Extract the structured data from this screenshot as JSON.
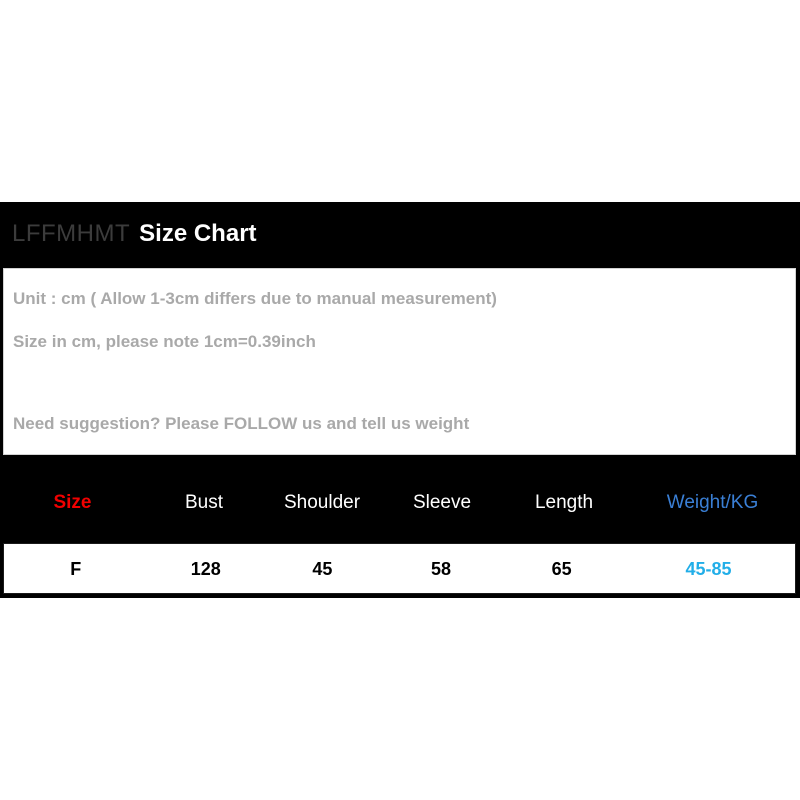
{
  "title": {
    "brand": "LFFMHMT",
    "main": "Size Chart"
  },
  "info": {
    "line1": "Unit : cm ( Allow 1-3cm differs due to manual measurement)",
    "line2": "Size in cm, please note 1cm=0.39inch",
    "line3": "Need suggestion? Please FOLLOW us and tell us weight"
  },
  "colors": {
    "size_header": "#f00000",
    "weight_header": "#3a7fd5",
    "weight_value": "#22aee8",
    "block_background": "#000000",
    "panel_background": "#ffffff",
    "info_text": "#a9a9a9",
    "brand_text": "#3c3c3c"
  },
  "chart_data": {
    "type": "table",
    "title": "LFFMHMT Size Chart",
    "columns": [
      "Size",
      "Bust",
      "Shoulder",
      "Sleeve",
      "Length",
      "Weight/KG"
    ],
    "rows": [
      [
        "F",
        "128",
        "45",
        "58",
        "65",
        "45-85"
      ]
    ],
    "units": "cm",
    "notes": [
      "Unit : cm ( Allow 1-3cm differs due to manual measurement)",
      "Size in cm, please note 1cm=0.39inch",
      "Need suggestion? Please FOLLOW us and tell us weight"
    ]
  }
}
